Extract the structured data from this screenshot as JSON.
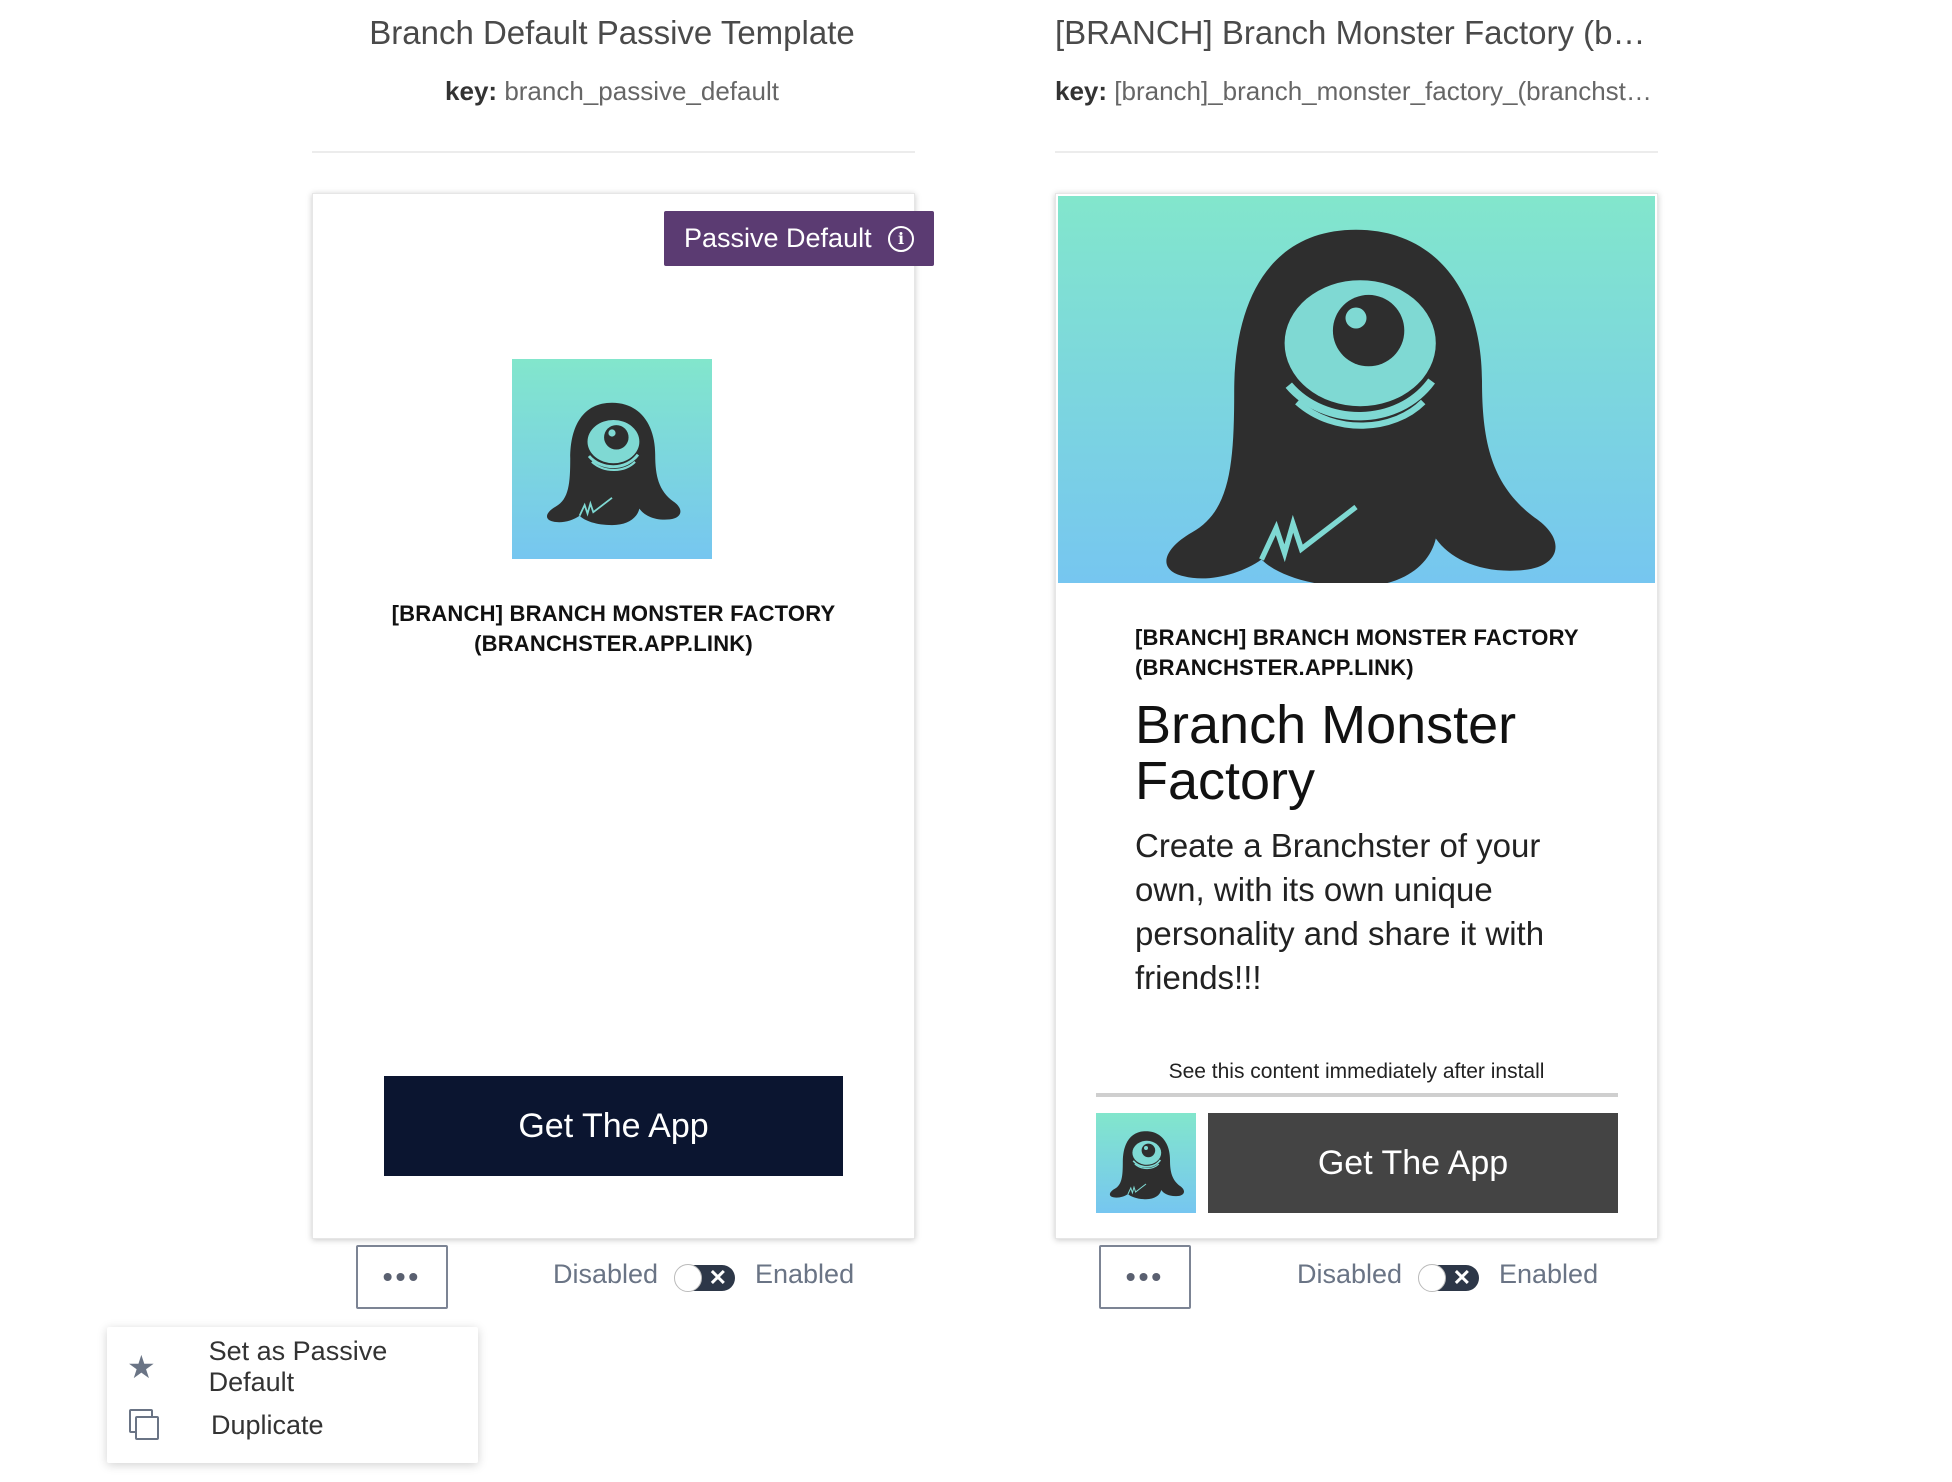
{
  "templates": [
    {
      "title": "Branch Default Passive Template",
      "key_label": "key:",
      "key_value": "branch_passive_default",
      "badge": "Passive Default",
      "badge_icon": "info-icon",
      "app_name_line1": "[BRANCH] BRANCH MONSTER FACTORY",
      "app_name_line2": "(BRANCHSTER.APP.LINK)",
      "cta": "Get The App",
      "toggle_off_label": "Disabled",
      "toggle_on_label": "Enabled",
      "more_label": "•••"
    },
    {
      "title": "[BRANCH] Branch Monster Factory (branchster.app.link)",
      "key_label": "key:",
      "key_value": "[branch]_branch_monster_factory_(branchster.app.link)",
      "app_name_line1": "[BRANCH] BRANCH MONSTER FACTORY",
      "app_name_line2": "(BRANCHSTER.APP.LINK)",
      "headline": "Branch Monster Factory",
      "description": "Create a Branchster of your own, with its own unique personality and share it with friends!!!",
      "install_note": "See this content immediately after install",
      "cta": "Get The App",
      "toggle_off_label": "Disabled",
      "toggle_on_label": "Enabled",
      "more_label": "•••"
    }
  ],
  "menu": {
    "items": [
      {
        "label": "Set as Passive Default",
        "icon": "star-icon"
      },
      {
        "label": "Duplicate",
        "icon": "duplicate-icon"
      }
    ]
  },
  "colors": {
    "badge": "#5b3b72",
    "cta_primary": "#0b1530",
    "cta_secondary": "#444444",
    "gradient_top": "#82e6cc",
    "gradient_bottom": "#76c6f0",
    "monster": "#2e2e2e"
  }
}
